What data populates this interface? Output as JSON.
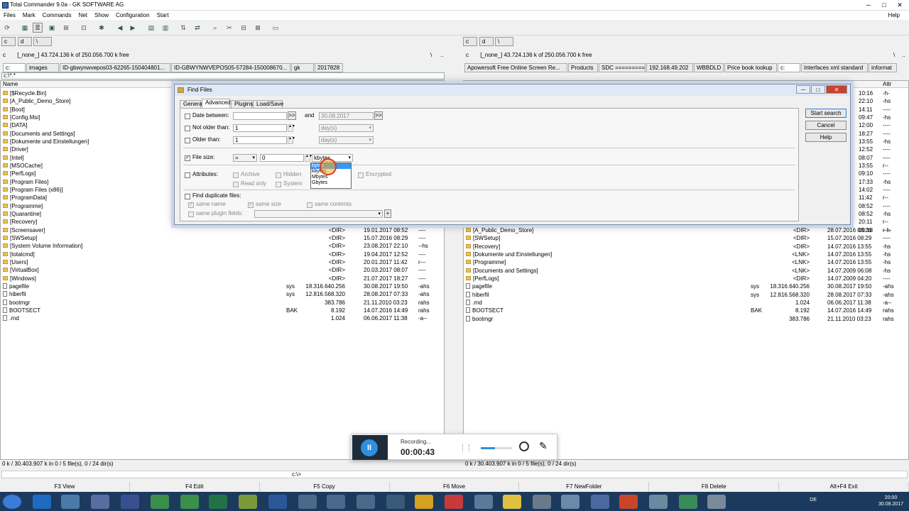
{
  "window": {
    "title": "Total Commander 9.0a - GK SOFTWARE AG",
    "min": "─",
    "max": "□",
    "close": "✕"
  },
  "menu": [
    "Files",
    "Mark",
    "Commands",
    "Net",
    "Show",
    "Configuration",
    "Start"
  ],
  "menu_help": "Help",
  "left": {
    "drive_btn": "c",
    "drive_d": "d",
    "drive_net": "\\",
    "drive_select": "c",
    "path_info": "[_none_]  43.724.136 k of 250.056.700 k free",
    "root": "\\",
    "up": "..",
    "tabs": [
      "c:",
      "images",
      "ID-gbwynwvepos03-62265-150404801...",
      "ID-GBWYNWVEPOS05-57284-150008670...",
      "gk",
      "2017828"
    ],
    "current_path": "c:\\*.*",
    "col_name": "Name",
    "rows": [
      {
        "name": "[$Recycle.Bin]",
        "ext": "",
        "size": "",
        "date": "",
        "attr": "",
        "dir": true
      },
      {
        "name": "[A_Public_Demo_Store]",
        "ext": "",
        "size": "",
        "date": "",
        "attr": "",
        "dir": true
      },
      {
        "name": "[Boot]",
        "ext": "",
        "size": "",
        "date": "",
        "attr": "",
        "dir": true
      },
      {
        "name": "[Config.Msi]",
        "ext": "",
        "size": "",
        "date": "",
        "attr": "",
        "dir": true
      },
      {
        "name": "[DATA]",
        "ext": "",
        "size": "",
        "date": "",
        "attr": "",
        "dir": true
      },
      {
        "name": "[Documents and Settings]",
        "ext": "",
        "size": "",
        "date": "",
        "attr": "",
        "dir": true
      },
      {
        "name": "[Dokumente und Einstellungen]",
        "ext": "",
        "size": "",
        "date": "",
        "attr": "",
        "dir": true
      },
      {
        "name": "[Driver]",
        "ext": "",
        "size": "",
        "date": "",
        "attr": "",
        "dir": true
      },
      {
        "name": "[Intel]",
        "ext": "",
        "size": "",
        "date": "",
        "attr": "",
        "dir": true
      },
      {
        "name": "[MSOCache]",
        "ext": "",
        "size": "",
        "date": "",
        "attr": "",
        "dir": true
      },
      {
        "name": "[PerfLogs]",
        "ext": "",
        "size": "",
        "date": "",
        "attr": "",
        "dir": true
      },
      {
        "name": "[Program Files]",
        "ext": "",
        "size": "",
        "date": "",
        "attr": "",
        "dir": true
      },
      {
        "name": "[Program Files (x86)]",
        "ext": "",
        "size": "",
        "date": "",
        "attr": "",
        "dir": true
      },
      {
        "name": "[ProgramData]",
        "ext": "",
        "size": "",
        "date": "",
        "attr": "",
        "dir": true
      },
      {
        "name": "[Programme]",
        "ext": "",
        "size": "",
        "date": "",
        "attr": "",
        "dir": true
      },
      {
        "name": "[Quarantine]",
        "ext": "",
        "size": "",
        "date": "",
        "attr": "",
        "dir": true
      },
      {
        "name": "[Recovery]",
        "ext": "",
        "size": "",
        "date": "",
        "attr": "",
        "dir": true
      },
      {
        "name": "[Screensaver]",
        "ext": "",
        "size": "<DIR>",
        "date": "19.01.2017 08:52",
        "attr": "----",
        "dir": true
      },
      {
        "name": "[SWSetup]",
        "ext": "",
        "size": "<DIR>",
        "date": "15.07.2016 08:29",
        "attr": "----",
        "dir": true
      },
      {
        "name": "[System Volume Information]",
        "ext": "",
        "size": "<DIR>",
        "date": "23.08.2017 22:10",
        "attr": "--hs",
        "dir": true
      },
      {
        "name": "[totalcmd]",
        "ext": "",
        "size": "<DIR>",
        "date": "19.04.2017 12:52",
        "attr": "----",
        "dir": true
      },
      {
        "name": "[Users]",
        "ext": "",
        "size": "<DIR>",
        "date": "20.01.2017 11:42",
        "attr": "r---",
        "dir": true
      },
      {
        "name": "[VirtualBox]",
        "ext": "",
        "size": "<DIR>",
        "date": "20.03.2017 08:07",
        "attr": "----",
        "dir": true
      },
      {
        "name": "[Windows]",
        "ext": "",
        "size": "<DIR>",
        "date": "21.07.2017 18:27",
        "attr": "----",
        "dir": true
      },
      {
        "name": "pagefile",
        "ext": "sys",
        "size": "18.316.640.256",
        "date": "30.08.2017 19:50",
        "attr": "-ahs",
        "dir": false
      },
      {
        "name": "hiberfil",
        "ext": "sys",
        "size": "12.816.568.320",
        "date": "28.08.2017 07:33",
        "attr": "-ahs",
        "dir": false
      },
      {
        "name": "bootmgr",
        "ext": "",
        "size": "383.786",
        "date": "21.11.2010 03:23",
        "attr": "rahs",
        "dir": false
      },
      {
        "name": "BOOTSECT",
        "ext": "BAK",
        "size": "8.192",
        "date": "14.07.2016 14:49",
        "attr": "rahs",
        "dir": false
      },
      {
        "name": ".rnd",
        "ext": "",
        "size": "1.024",
        "date": "06.06.2017 11:38",
        "attr": "-a--",
        "dir": false
      }
    ],
    "status": "0 k / 30.403.907 k in 0 / 5 file(s), 0 / 24 dir(s)"
  },
  "right": {
    "drive_btn": "c",
    "drive_d": "d",
    "drive_net": "\\",
    "drive_select": "c",
    "path_info": "[_none_]  43.724.136 k of 250.056.700 k free",
    "root": "\\",
    "up": "..",
    "tabs": [
      "Apowersoft Free Online Screen Re...",
      "Products",
      "SDC ==========",
      "192.168.49.202",
      "WBBDLD",
      "Price book lookup",
      "c:",
      "Interfaces xml standard",
      "informat"
    ],
    "col_attr": "Attr",
    "top_attrs": [
      {
        "time": "10:16",
        "attr": "-h-"
      },
      {
        "time": "22:10",
        "attr": "-hs"
      },
      {
        "time": "14:11",
        "attr": "----"
      },
      {
        "time": "09:47",
        "attr": "-hs"
      },
      {
        "time": "12:00",
        "attr": "----"
      },
      {
        "time": "18:27",
        "attr": "----"
      },
      {
        "time": "13:55",
        "attr": "-hs"
      },
      {
        "time": "12:52",
        "attr": "----"
      },
      {
        "time": "08:07",
        "attr": "----"
      },
      {
        "time": "13:55",
        "attr": "r--"
      },
      {
        "time": "09:10",
        "attr": "----"
      },
      {
        "time": "17:33",
        "attr": "-hs"
      },
      {
        "time": "14:02",
        "attr": "----"
      },
      {
        "time": "11:42",
        "attr": "r--"
      },
      {
        "time": "08:52",
        "attr": "----"
      },
      {
        "time": "08:52",
        "attr": "-hs"
      },
      {
        "time": "20:11",
        "attr": "r--"
      },
      {
        "time": "09:18",
        "attr": "r-h-"
      }
    ],
    "rows": [
      {
        "name": "[A_Public_Demo_Store]",
        "ext": "",
        "size": "<DIR>",
        "date": "28.07.2016 08:26",
        "attr": "----",
        "dir": true
      },
      {
        "name": "[SWSetup]",
        "ext": "",
        "size": "<DIR>",
        "date": "15.07.2016 08:29",
        "attr": "----",
        "dir": true
      },
      {
        "name": "[Recovery]",
        "ext": "",
        "size": "<DIR>",
        "date": "14.07.2016 13:55",
        "attr": "-hs",
        "dir": true
      },
      {
        "name": "[Dokumente und Einstellungen]",
        "ext": "",
        "size": "<LNK>",
        "date": "14.07.2016 13:55",
        "attr": "-hs",
        "dir": true
      },
      {
        "name": "[Programme]",
        "ext": "",
        "size": "<LNK>",
        "date": "14.07.2016 13:55",
        "attr": "-hs",
        "dir": true
      },
      {
        "name": "[Documents and Settings]",
        "ext": "",
        "size": "<LNK>",
        "date": "14.07.2009 06:08",
        "attr": "-hs",
        "dir": true
      },
      {
        "name": "[PerfLogs]",
        "ext": "",
        "size": "<DIR>",
        "date": "14.07.2009 04:20",
        "attr": "----",
        "dir": true
      },
      {
        "name": "pagefile",
        "ext": "sys",
        "size": "18.316.640.256",
        "date": "30.08.2017 19:50",
        "attr": "-ahs",
        "dir": false
      },
      {
        "name": "hiberfil",
        "ext": "sys",
        "size": "12.816.568.320",
        "date": "28.08.2017 07:33",
        "attr": "-ahs",
        "dir": false
      },
      {
        "name": ".rnd",
        "ext": "",
        "size": "1.024",
        "date": "06.06.2017 11:38",
        "attr": "-a--",
        "dir": false
      },
      {
        "name": "BOOTSECT",
        "ext": "BAK",
        "size": "8.192",
        "date": "14.07.2016 14:49",
        "attr": "rahs",
        "dir": false
      },
      {
        "name": "bootmgr",
        "ext": "",
        "size": "383.786",
        "date": "21.11.2010 03:23",
        "attr": "rahs",
        "dir": false
      }
    ],
    "status": "0 k / 30.403.907 k in 0 / 5 file(s), 0 / 24 dir(s)"
  },
  "cmdline": "c:\\>",
  "fkeys": [
    "F3 View",
    "F4 Edit",
    "F5 Copy",
    "F6 Move",
    "F7 NewFolder",
    "F8 Delete",
    "Alt+F4 Exit"
  ],
  "dialog": {
    "title": "Find Files",
    "tabs": [
      "General",
      "Advanced",
      "Plugins",
      "Load/Save"
    ],
    "date_between": "Date between:",
    "date_btn": ">>",
    "and": "and",
    "date_to": "30.08.2017",
    "not_older": "Not older than:",
    "not_older_val": "1",
    "older": "Older than:",
    "older_val": "1",
    "unit_days": "day(s)",
    "file_size": "File size:",
    "size_op": "=",
    "size_val": "0",
    "size_unit": "kbytes",
    "size_options": [
      "bytes",
      "kbytes",
      "Mbytes",
      "Gbytes"
    ],
    "attributes": "Attributes:",
    "archive": "Archive",
    "hidden": "Hidden",
    "encrypted": "Encrypted",
    "readonly": "Read only",
    "system": "System",
    "find_dup": "Find duplicate files:",
    "same_name": "same name",
    "same_size": "same size",
    "same_contents": "same contents",
    "same_plugin": "same plugin fields:",
    "plus": "+",
    "check": "✓",
    "start": "Start search",
    "cancel": "Cancel",
    "help": "Help"
  },
  "recorder": {
    "label": "Recording...",
    "time": "00:00:43",
    "pause": "II"
  },
  "clock": {
    "time": "20:00",
    "date": "30.08.2017",
    "lang": "DE"
  },
  "colors": {
    "taskbar": "#1c3a5e",
    "highlight": "#3399ff",
    "folder": "#e8c35a"
  }
}
